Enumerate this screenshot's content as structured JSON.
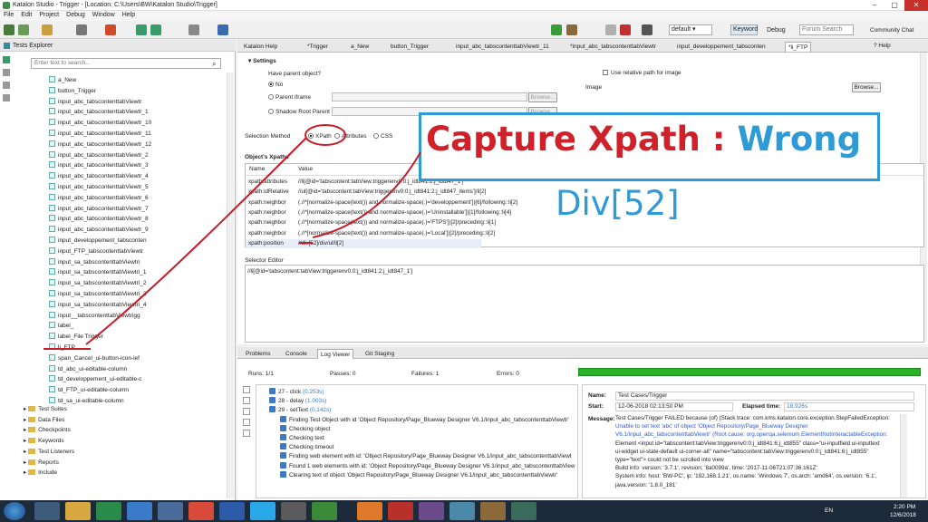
{
  "window": {
    "title": "Katalon Studio - Trigger - [Location: C:\\Users\\BW\\Katalon Studio\\Trigger]"
  },
  "menu": [
    "File",
    "Edit",
    "Project",
    "Debug",
    "Window",
    "Help"
  ],
  "toolbar": {
    "profile": "default",
    "keyword_btn": "Keyword",
    "debug_btn": "Debug",
    "forum_placeholder": "Forum Search",
    "community": "Community Chat"
  },
  "explorer": {
    "title": "Tests Explorer",
    "search_placeholder": "Enter text to search...",
    "items": [
      "a_New",
      "button_Trigger",
      "input_abc_tabscontenttabViewtr",
      "input_abc_tabscontenttabViewtr_1",
      "input_abc_tabscontenttabViewtr_10",
      "input_abc_tabscontenttabViewtr_11",
      "input_abc_tabscontenttabViewtr_12",
      "input_abc_tabscontenttabViewtr_2",
      "input_abc_tabscontenttabViewtr_3",
      "input_abc_tabscontenttabViewtr_4",
      "input_abc_tabscontenttabViewtr_5",
      "input_abc_tabscontenttabViewtr_6",
      "input_abc_tabscontenttabViewtr_7",
      "input_abc_tabscontenttabViewtr_8",
      "input_abc_tabscontenttabViewtr_9",
      "input_developpement_tabsconten",
      "input_FTP_tabscontenttabViewtr",
      "input_sa_tabscontenttabViewtri",
      "input_sa_tabscontenttabViewtri_1",
      "input_sa_tabscontenttabViewtri_2",
      "input_sa_tabscontenttabViewtri_3",
      "input_sa_tabscontenttabViewtri_4",
      "input__tabscontenttabViewtrigg",
      "label_",
      "label_File Trigger",
      "li_FTP",
      "span_Cancel_ui-button-icon-lef",
      "td_abc_ui-editable-column",
      "td_developpement_ui-editable-c",
      "td_FTP_ui-editable-column",
      "td_sa_ui-editable-column"
    ],
    "folders": [
      "Test Suites",
      "Data Files",
      "Checkpoints",
      "Keywords",
      "Test Listeners",
      "Reports",
      "Include"
    ]
  },
  "tabs": [
    "Katalon Help",
    "*Trigger",
    "a_New",
    "button_Trigger",
    "input_abc_tabscontenttabViewtr_11",
    "*input_abc_tabscontenttabViewtr",
    "input_developpement_tabsconten",
    "*li_FTP"
  ],
  "settings": {
    "section": "Settings",
    "parent_q": "Have parent object?",
    "no": "No",
    "parent_iframe": "Parent iframe",
    "shadow_root": "Shadow Root Parent",
    "browse": "Browse...",
    "relative_path": "Use relative path for image",
    "image": "Image",
    "selection_method": "Selection Method",
    "xpath": "XPath",
    "attributes": "Attributes",
    "css": "CSS"
  },
  "xpaths": {
    "title": "Object's Xpaths",
    "col_name": "Name",
    "col_value": "Value",
    "rows": [
      {
        "name": "xpath:attributes",
        "value": "//li[@id='tabscontent:tabView:triggerenv0:0:j_idt841:2:j_idt847_1']"
      },
      {
        "name": "xpath:idRelative",
        "value": "//ul[@id='tabscontent:tabView:triggerenv0:0:j_idt841:2:j_idt847_items']/li[2]"
      },
      {
        "name": "xpath:neighbor",
        "value": "(.//*[normalize-space(text()) and normalize-space(.)='developpement'])[6]/following::li[2]"
      },
      {
        "name": "xpath:neighbor",
        "value": "(.//*[normalize-space(text()) and normalize-space(.)='Uninstallable'])[1]/following::li[4]"
      },
      {
        "name": "xpath:neighbor",
        "value": "(.//*[normalize-space(text()) and normalize-space(.)='FTPS'])[2]/preceding::li[1]"
      },
      {
        "name": "xpath:neighbor",
        "value": "(.//*[normalize-space(text()) and normalize-space(.)='Local'])[2]/preceding::li[2]"
      },
      {
        "name": "xpath:position",
        "value": "//div[52]/div/ul/li[2]"
      }
    ]
  },
  "selector_editor": {
    "title": "Selector Editor",
    "value": "//li[@id='tabscontent:tabView:triggerenv0:0:j_idt841:2:j_idt847_1']"
  },
  "bottom_tabs": [
    "Problems",
    "Console",
    "Log Viewer",
    "Git Staging"
  ],
  "runs": {
    "runs": "Runs: 1/1",
    "passes": "Passes: 0",
    "failures": "Failures: 1",
    "errors": "Errors: 0"
  },
  "log": [
    {
      "num": "27",
      "text": "- click",
      "time": "(0.253s)"
    },
    {
      "num": "28",
      "text": "- delay",
      "time": "(1.003s)"
    },
    {
      "num": "29",
      "text": "- setText",
      "time": "(0.142s)"
    },
    {
      "text": "Finding Test Object with id 'Object Repository/Page_Blueway Designer V6.1/input_abc_tabscontenttabViewtr'"
    },
    {
      "text": "Checking object"
    },
    {
      "text": "Checking text"
    },
    {
      "text": "Checking timeout"
    },
    {
      "text": "Finding web element with id: 'Object Repository/Page_Blueway Designer V6.1/input_abc_tabscontenttabViewt"
    },
    {
      "text": "Found 1 web elements with id: 'Object Repository/Page_Blueway Designer V6.1/input_abc_tabscontenttabView"
    },
    {
      "text": "Clearing text of object 'Object Repository/Page_Blueway Designer V6.1/input_abc_tabscontenttabViewtr'"
    }
  ],
  "detail": {
    "name_label": "Name:",
    "name_value": "Test Cases/Trigger",
    "start_label": "Start:",
    "start_value": "12-06-2018 02:13:50 PM",
    "elapsed_label": "Elapsed time:",
    "elapsed_value": "18.926s",
    "message_label": "Message:",
    "message_lines": [
      "Test Cases/Trigger FAILED because (of) (Stack trace: com.kms.katalon.core.exception.StepFailedException:",
      "Unable to set text 'abc' of object 'Object Repository/Page_Blueway Designer",
      "V6.1/input_abc_tabscontenttabViewtr' (Root cause: org.openqa.selenium.ElementNotInteractableException:",
      "Element <input id=\"tabscontent:tabView:triggerenv0:0:j_idt841:6:j_idt855\" class=\"ui-inputfield ui-inputtext",
      "ui-widget ui-state-default ui-corner-all\" name=\"tabscontent:tabView:triggerenv0:0:j_idt841:6:j_idt855\"",
      "type=\"text\"> could not be scrolled into view",
      "Build info: version: '3.7.1', revision: '8a0099a', time: '2017-11-06T21:07:36.161Z'",
      "System info: host: 'BW-PC', ip: '192.168.1.21', os.name: 'Windows 7', os.arch: 'amd64', os.version: '6.1',",
      "java.version: '1.8.0_181'"
    ]
  },
  "annotation": {
    "line1_red": "Capture Xpath : ",
    "line1_blue": "Wrong",
    "line2": "Div[52]"
  },
  "taskbar": {
    "lang": "EN",
    "time": "2:20 PM",
    "date": "12/6/2018"
  }
}
